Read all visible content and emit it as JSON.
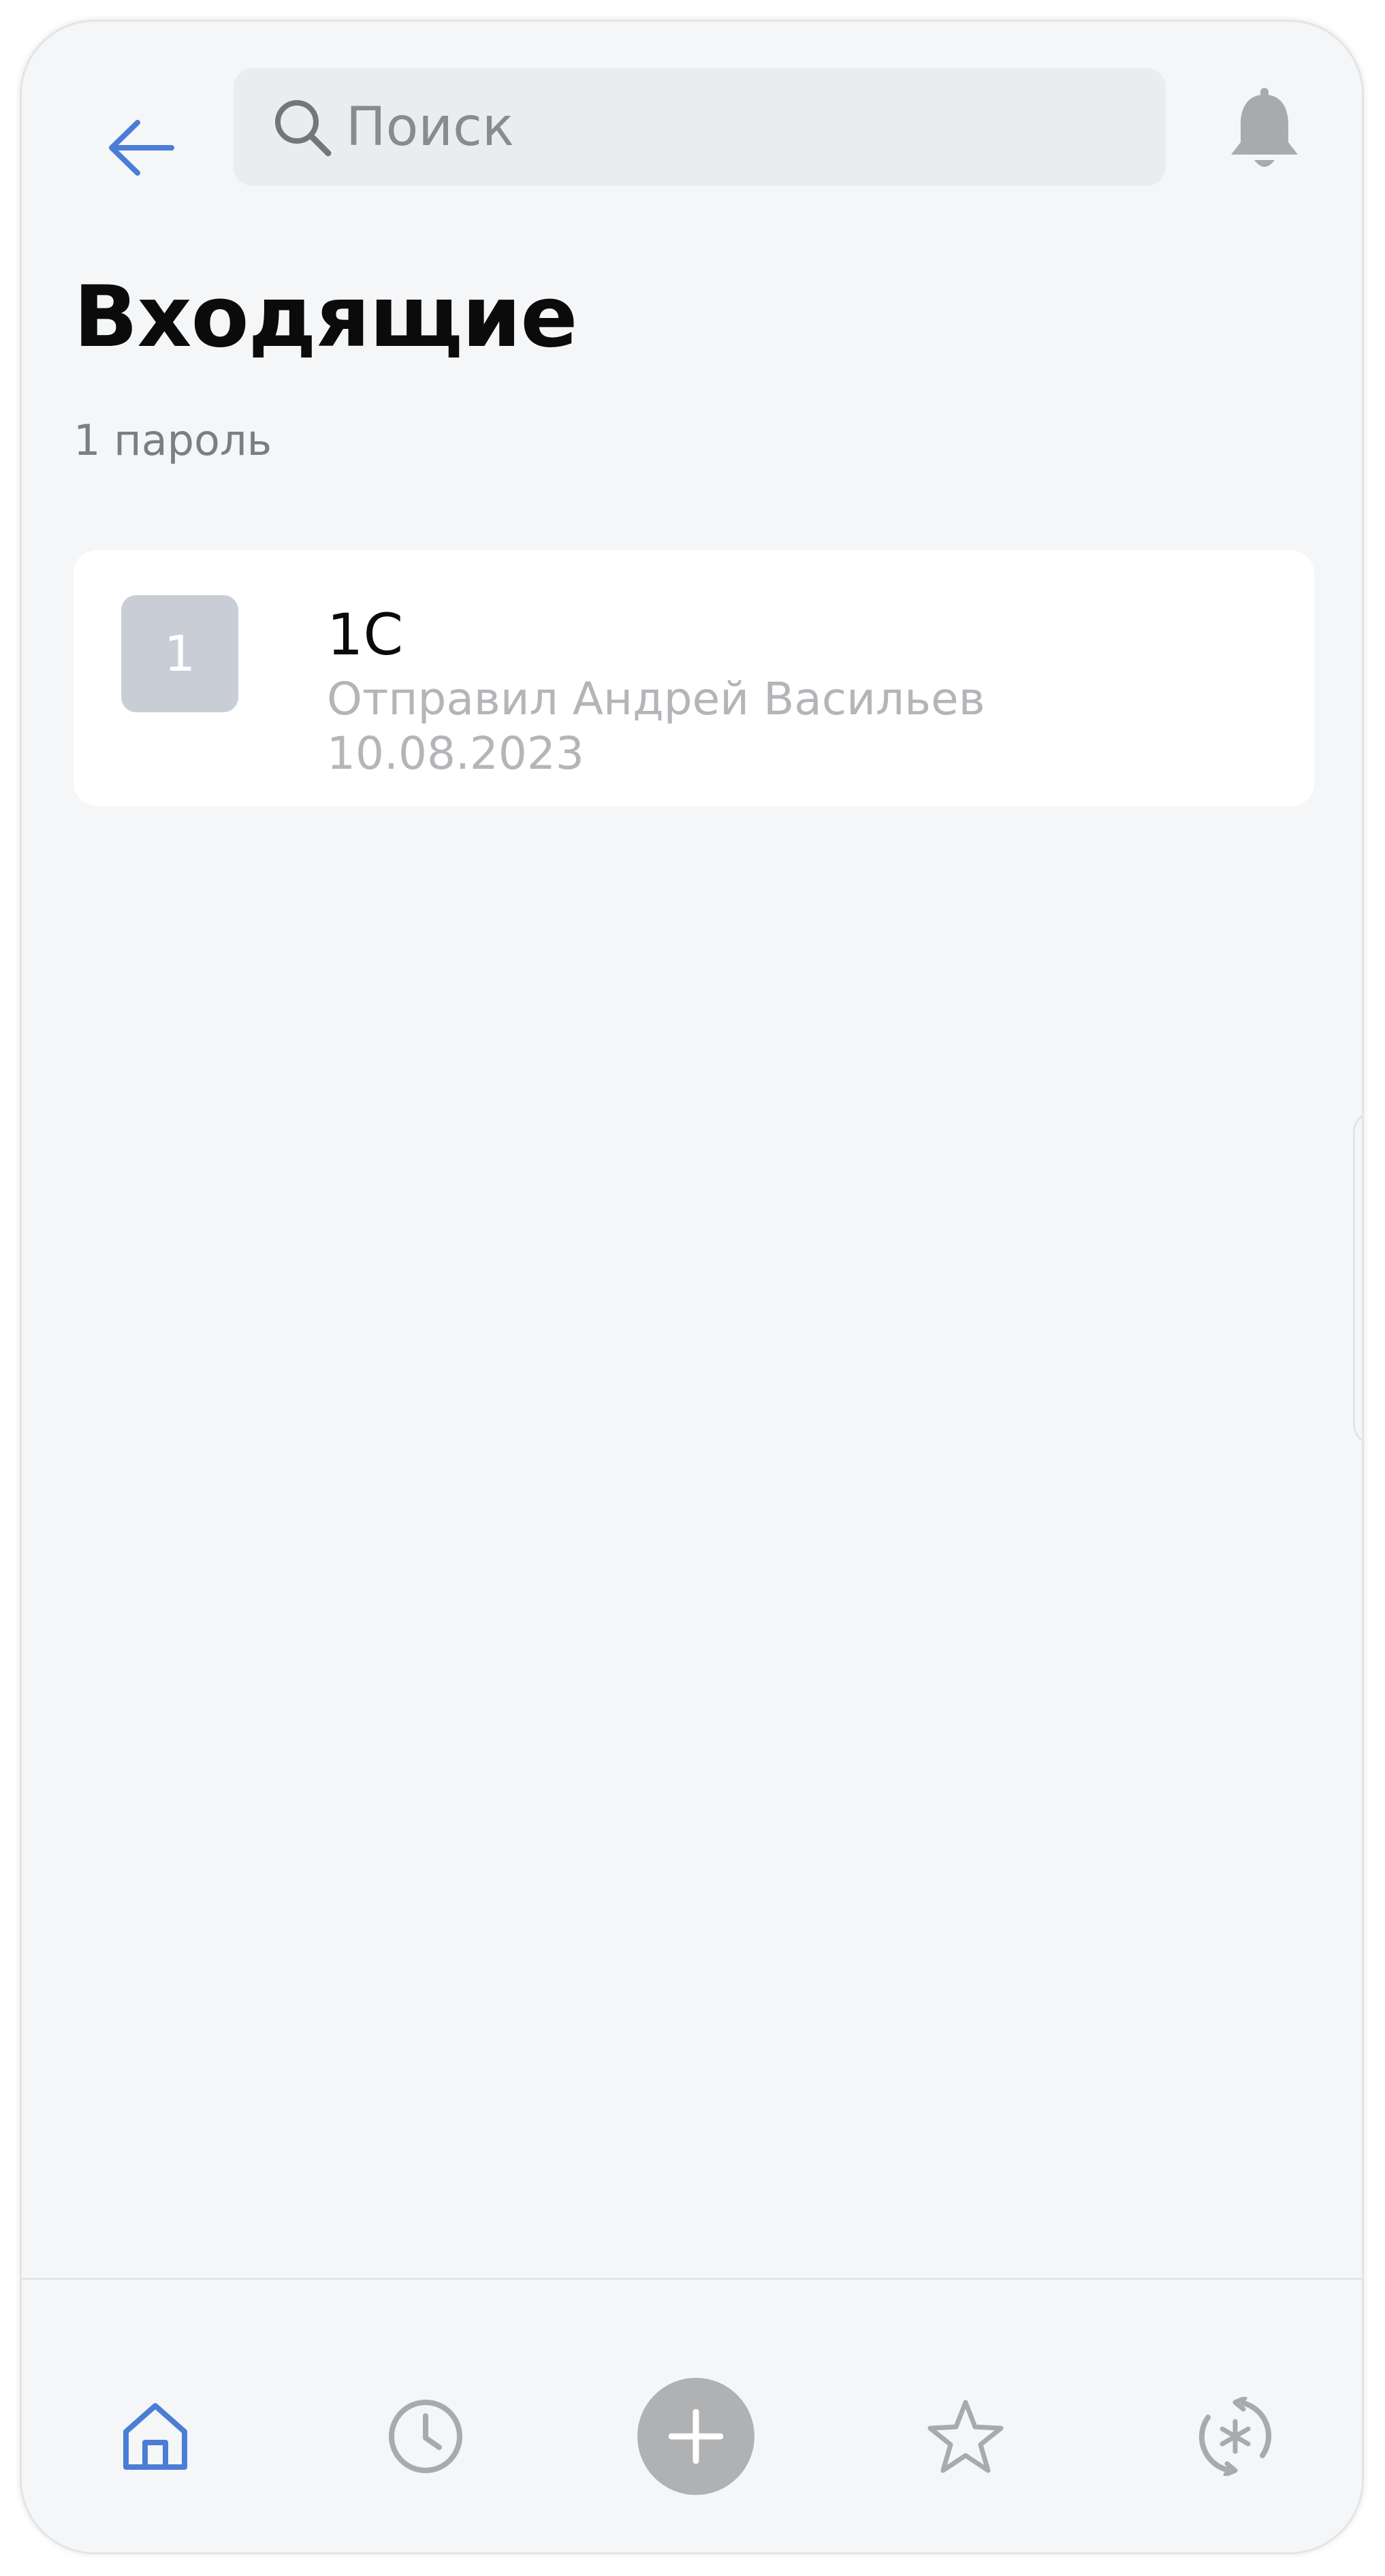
{
  "header": {
    "back_icon": "arrow-left-icon",
    "search": {
      "placeholder": "Поиск",
      "value": "",
      "icon": "search-icon"
    },
    "notifications_icon": "bell-icon"
  },
  "main": {
    "title": "Входящие",
    "count_text": "1 пароль",
    "items": [
      {
        "avatar_text": "1",
        "title": "1C",
        "subtitle": "Отправил Андрей Васильев",
        "date": "10.08.2023"
      }
    ]
  },
  "tabbar": {
    "tabs": [
      {
        "icon": "home-icon",
        "active": true
      },
      {
        "icon": "clock-icon",
        "active": false
      },
      {
        "icon": "plus-icon",
        "active": false
      },
      {
        "icon": "star-icon",
        "active": false
      },
      {
        "icon": "password-generator-icon",
        "active": false
      }
    ]
  },
  "colors": {
    "accent": "#4a7dd5",
    "icon_inactive": "#a9aaac",
    "background": "#f5f6f8",
    "card": "#ffffff",
    "avatar": "#c9ced6",
    "title": "#0b0b0c",
    "secondary_text": "#b4b5b9"
  }
}
